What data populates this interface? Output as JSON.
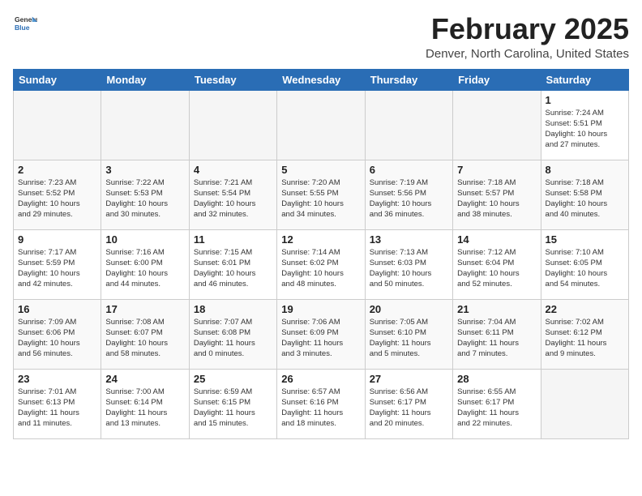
{
  "header": {
    "logo_general": "General",
    "logo_blue": "Blue",
    "month_title": "February 2025",
    "location": "Denver, North Carolina, United States"
  },
  "weekdays": [
    "Sunday",
    "Monday",
    "Tuesday",
    "Wednesday",
    "Thursday",
    "Friday",
    "Saturday"
  ],
  "weeks": [
    [
      {
        "day": "",
        "info": ""
      },
      {
        "day": "",
        "info": ""
      },
      {
        "day": "",
        "info": ""
      },
      {
        "day": "",
        "info": ""
      },
      {
        "day": "",
        "info": ""
      },
      {
        "day": "",
        "info": ""
      },
      {
        "day": "1",
        "info": "Sunrise: 7:24 AM\nSunset: 5:51 PM\nDaylight: 10 hours\nand 27 minutes."
      }
    ],
    [
      {
        "day": "2",
        "info": "Sunrise: 7:23 AM\nSunset: 5:52 PM\nDaylight: 10 hours\nand 29 minutes."
      },
      {
        "day": "3",
        "info": "Sunrise: 7:22 AM\nSunset: 5:53 PM\nDaylight: 10 hours\nand 30 minutes."
      },
      {
        "day": "4",
        "info": "Sunrise: 7:21 AM\nSunset: 5:54 PM\nDaylight: 10 hours\nand 32 minutes."
      },
      {
        "day": "5",
        "info": "Sunrise: 7:20 AM\nSunset: 5:55 PM\nDaylight: 10 hours\nand 34 minutes."
      },
      {
        "day": "6",
        "info": "Sunrise: 7:19 AM\nSunset: 5:56 PM\nDaylight: 10 hours\nand 36 minutes."
      },
      {
        "day": "7",
        "info": "Sunrise: 7:18 AM\nSunset: 5:57 PM\nDaylight: 10 hours\nand 38 minutes."
      },
      {
        "day": "8",
        "info": "Sunrise: 7:18 AM\nSunset: 5:58 PM\nDaylight: 10 hours\nand 40 minutes."
      }
    ],
    [
      {
        "day": "9",
        "info": "Sunrise: 7:17 AM\nSunset: 5:59 PM\nDaylight: 10 hours\nand 42 minutes."
      },
      {
        "day": "10",
        "info": "Sunrise: 7:16 AM\nSunset: 6:00 PM\nDaylight: 10 hours\nand 44 minutes."
      },
      {
        "day": "11",
        "info": "Sunrise: 7:15 AM\nSunset: 6:01 PM\nDaylight: 10 hours\nand 46 minutes."
      },
      {
        "day": "12",
        "info": "Sunrise: 7:14 AM\nSunset: 6:02 PM\nDaylight: 10 hours\nand 48 minutes."
      },
      {
        "day": "13",
        "info": "Sunrise: 7:13 AM\nSunset: 6:03 PM\nDaylight: 10 hours\nand 50 minutes."
      },
      {
        "day": "14",
        "info": "Sunrise: 7:12 AM\nSunset: 6:04 PM\nDaylight: 10 hours\nand 52 minutes."
      },
      {
        "day": "15",
        "info": "Sunrise: 7:10 AM\nSunset: 6:05 PM\nDaylight: 10 hours\nand 54 minutes."
      }
    ],
    [
      {
        "day": "16",
        "info": "Sunrise: 7:09 AM\nSunset: 6:06 PM\nDaylight: 10 hours\nand 56 minutes."
      },
      {
        "day": "17",
        "info": "Sunrise: 7:08 AM\nSunset: 6:07 PM\nDaylight: 10 hours\nand 58 minutes."
      },
      {
        "day": "18",
        "info": "Sunrise: 7:07 AM\nSunset: 6:08 PM\nDaylight: 11 hours\nand 0 minutes."
      },
      {
        "day": "19",
        "info": "Sunrise: 7:06 AM\nSunset: 6:09 PM\nDaylight: 11 hours\nand 3 minutes."
      },
      {
        "day": "20",
        "info": "Sunrise: 7:05 AM\nSunset: 6:10 PM\nDaylight: 11 hours\nand 5 minutes."
      },
      {
        "day": "21",
        "info": "Sunrise: 7:04 AM\nSunset: 6:11 PM\nDaylight: 11 hours\nand 7 minutes."
      },
      {
        "day": "22",
        "info": "Sunrise: 7:02 AM\nSunset: 6:12 PM\nDaylight: 11 hours\nand 9 minutes."
      }
    ],
    [
      {
        "day": "23",
        "info": "Sunrise: 7:01 AM\nSunset: 6:13 PM\nDaylight: 11 hours\nand 11 minutes."
      },
      {
        "day": "24",
        "info": "Sunrise: 7:00 AM\nSunset: 6:14 PM\nDaylight: 11 hours\nand 13 minutes."
      },
      {
        "day": "25",
        "info": "Sunrise: 6:59 AM\nSunset: 6:15 PM\nDaylight: 11 hours\nand 15 minutes."
      },
      {
        "day": "26",
        "info": "Sunrise: 6:57 AM\nSunset: 6:16 PM\nDaylight: 11 hours\nand 18 minutes."
      },
      {
        "day": "27",
        "info": "Sunrise: 6:56 AM\nSunset: 6:17 PM\nDaylight: 11 hours\nand 20 minutes."
      },
      {
        "day": "28",
        "info": "Sunrise: 6:55 AM\nSunset: 6:17 PM\nDaylight: 11 hours\nand 22 minutes."
      },
      {
        "day": "",
        "info": ""
      }
    ]
  ]
}
